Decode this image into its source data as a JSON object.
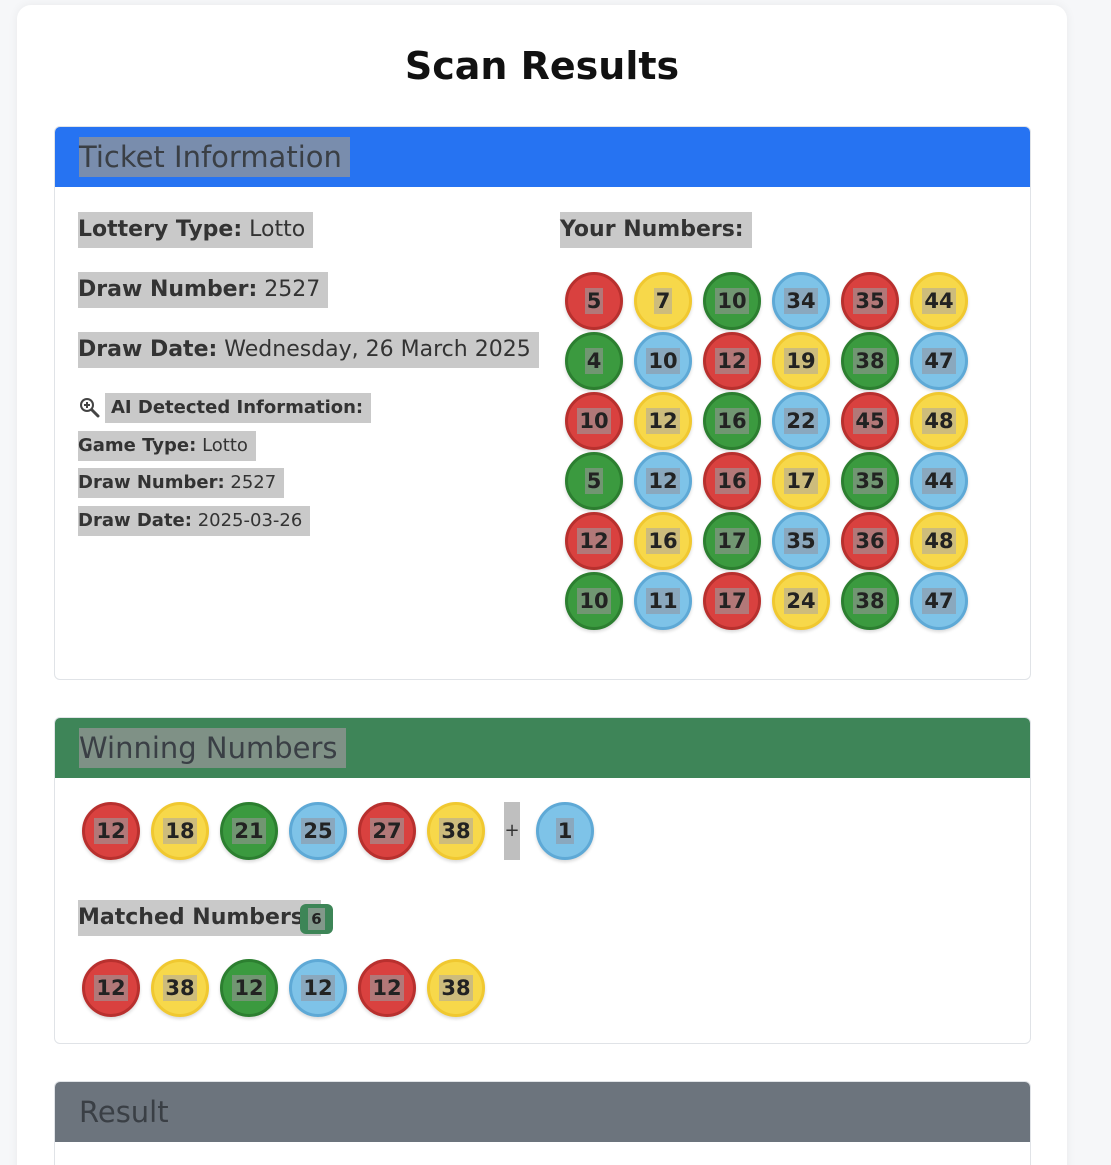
{
  "page": {
    "title": "Scan Results"
  },
  "ticket": {
    "header": "Ticket Information",
    "header_color": "#2673f2",
    "lottery_type_label": "Lottery Type:",
    "lottery_type": "Lotto",
    "draw_number_label": "Draw Number:",
    "draw_number": "2527",
    "draw_date_label": "Draw Date:",
    "draw_date": "Wednesday, 26 March 2025",
    "ai_label": "AI Detected Information:",
    "ai_icon": "magnifier-plus-icon",
    "ai": {
      "game_type_label": "Game Type:",
      "game_type": "Lotto",
      "draw_number_label": "Draw Number:",
      "draw_number": "2527",
      "draw_date_label": "Draw Date:",
      "draw_date": "2025-03-26"
    },
    "your_numbers_label": "Your Numbers:",
    "rows": [
      [
        [
          "5",
          "red"
        ],
        [
          "7",
          "yellow"
        ],
        [
          "10",
          "green"
        ],
        [
          "34",
          "blue"
        ],
        [
          "35",
          "red"
        ],
        [
          "44",
          "yellow"
        ]
      ],
      [
        [
          "4",
          "green"
        ],
        [
          "10",
          "blue"
        ],
        [
          "12",
          "red"
        ],
        [
          "19",
          "yellow"
        ],
        [
          "38",
          "green"
        ],
        [
          "47",
          "blue"
        ]
      ],
      [
        [
          "10",
          "red"
        ],
        [
          "12",
          "yellow"
        ],
        [
          "16",
          "green"
        ],
        [
          "22",
          "blue"
        ],
        [
          "45",
          "red"
        ],
        [
          "48",
          "yellow"
        ]
      ],
      [
        [
          "5",
          "green"
        ],
        [
          "12",
          "blue"
        ],
        [
          "16",
          "red"
        ],
        [
          "17",
          "yellow"
        ],
        [
          "35",
          "green"
        ],
        [
          "44",
          "blue"
        ]
      ],
      [
        [
          "12",
          "red"
        ],
        [
          "16",
          "yellow"
        ],
        [
          "17",
          "green"
        ],
        [
          "35",
          "blue"
        ],
        [
          "36",
          "red"
        ],
        [
          "48",
          "yellow"
        ]
      ],
      [
        [
          "10",
          "green"
        ],
        [
          "11",
          "blue"
        ],
        [
          "17",
          "red"
        ],
        [
          "24",
          "yellow"
        ],
        [
          "38",
          "green"
        ],
        [
          "47",
          "blue"
        ]
      ]
    ]
  },
  "winning": {
    "header": "Winning Numbers",
    "header_color": "#3e8558",
    "numbers": [
      [
        "12",
        "red"
      ],
      [
        "18",
        "yellow"
      ],
      [
        "21",
        "green"
      ],
      [
        "25",
        "blue"
      ],
      [
        "27",
        "red"
      ],
      [
        "38",
        "yellow"
      ]
    ],
    "plus": "+",
    "bonus": [
      "1",
      "blue"
    ],
    "matched_label": "Matched Numbers:",
    "matched_count": "6",
    "matched": [
      [
        "12",
        "red"
      ],
      [
        "38",
        "yellow"
      ],
      [
        "12",
        "green"
      ],
      [
        "12",
        "blue"
      ],
      [
        "12",
        "red"
      ],
      [
        "38",
        "yellow"
      ]
    ]
  },
  "result": {
    "header": "Result",
    "header_color": "#6c747d"
  }
}
